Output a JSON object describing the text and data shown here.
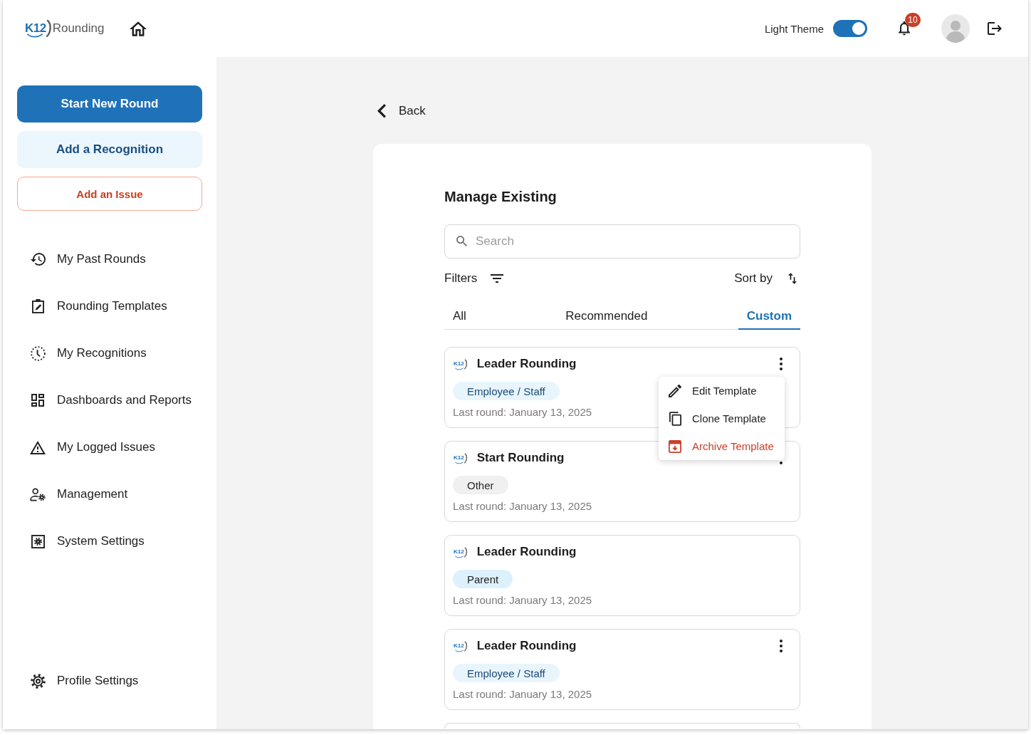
{
  "header": {
    "logo": {
      "mark": "K12",
      "name": "Rounding"
    },
    "theme_toggle": {
      "label": "Light Theme",
      "on": true
    },
    "notifications": {
      "count": "10"
    }
  },
  "sidebar": {
    "actions": [
      {
        "label": "Start New Round",
        "kind": "primary"
      },
      {
        "label": "Add a Recognition",
        "kind": "secondary"
      },
      {
        "label": "Add an Issue",
        "kind": "danger"
      }
    ],
    "items": [
      {
        "label": "My Past Rounds",
        "selected": false
      },
      {
        "label": "Rounding Templates",
        "selected": false
      },
      {
        "label": "My Recognitions",
        "selected": false
      },
      {
        "label": "Dashboards and Reports",
        "selected": false
      },
      {
        "label": "My Logged Issues",
        "selected": false
      },
      {
        "label": "Management",
        "selected": false
      },
      {
        "label": "System Settings",
        "selected": false
      }
    ],
    "footer_items": [
      {
        "label": "Profile Settings",
        "selected": false
      }
    ]
  },
  "main": {
    "back": "Back",
    "title": "Manage Existing",
    "search": {
      "placeholder": "Search"
    },
    "filters": "Filters",
    "sort": "Sort by",
    "tabs": [
      {
        "label": "All",
        "selected": false
      },
      {
        "label": "Recommended",
        "selected": false
      },
      {
        "label": "Custom",
        "selected": true
      }
    ],
    "templates": [
      {
        "logo": "K12",
        "title": "Leader Rounding",
        "more_button": true,
        "tag": {
          "label": "Employee / Staff",
          "kind": "staff"
        },
        "last_round": "Last round: January 13, 2025",
        "menu": [
          {
            "label": "Edit Template",
            "kind": "edit"
          },
          {
            "label": "Clone Template",
            "kind": "clone"
          },
          {
            "label": "Archive Template",
            "kind": "archive"
          }
        ]
      },
      {
        "logo": "K12",
        "title": "Start Rounding",
        "more_button": true,
        "tag": {
          "label": "Other",
          "kind": "other"
        },
        "last_round": "Last round: January 13, 2025"
      },
      {
        "logo": "K12",
        "title": "Leader Rounding",
        "more_button": false,
        "tag": {
          "label": "Parent",
          "kind": "parent"
        },
        "last_round": "Last round: January 13, 2025"
      },
      {
        "logo": "K12",
        "title": "Leader Rounding",
        "more_button": true,
        "tag": {
          "label": "Employee / Staff",
          "kind": "staff"
        },
        "last_round": "Last round: January 13, 2025"
      }
    ],
    "more_below": true
  }
}
